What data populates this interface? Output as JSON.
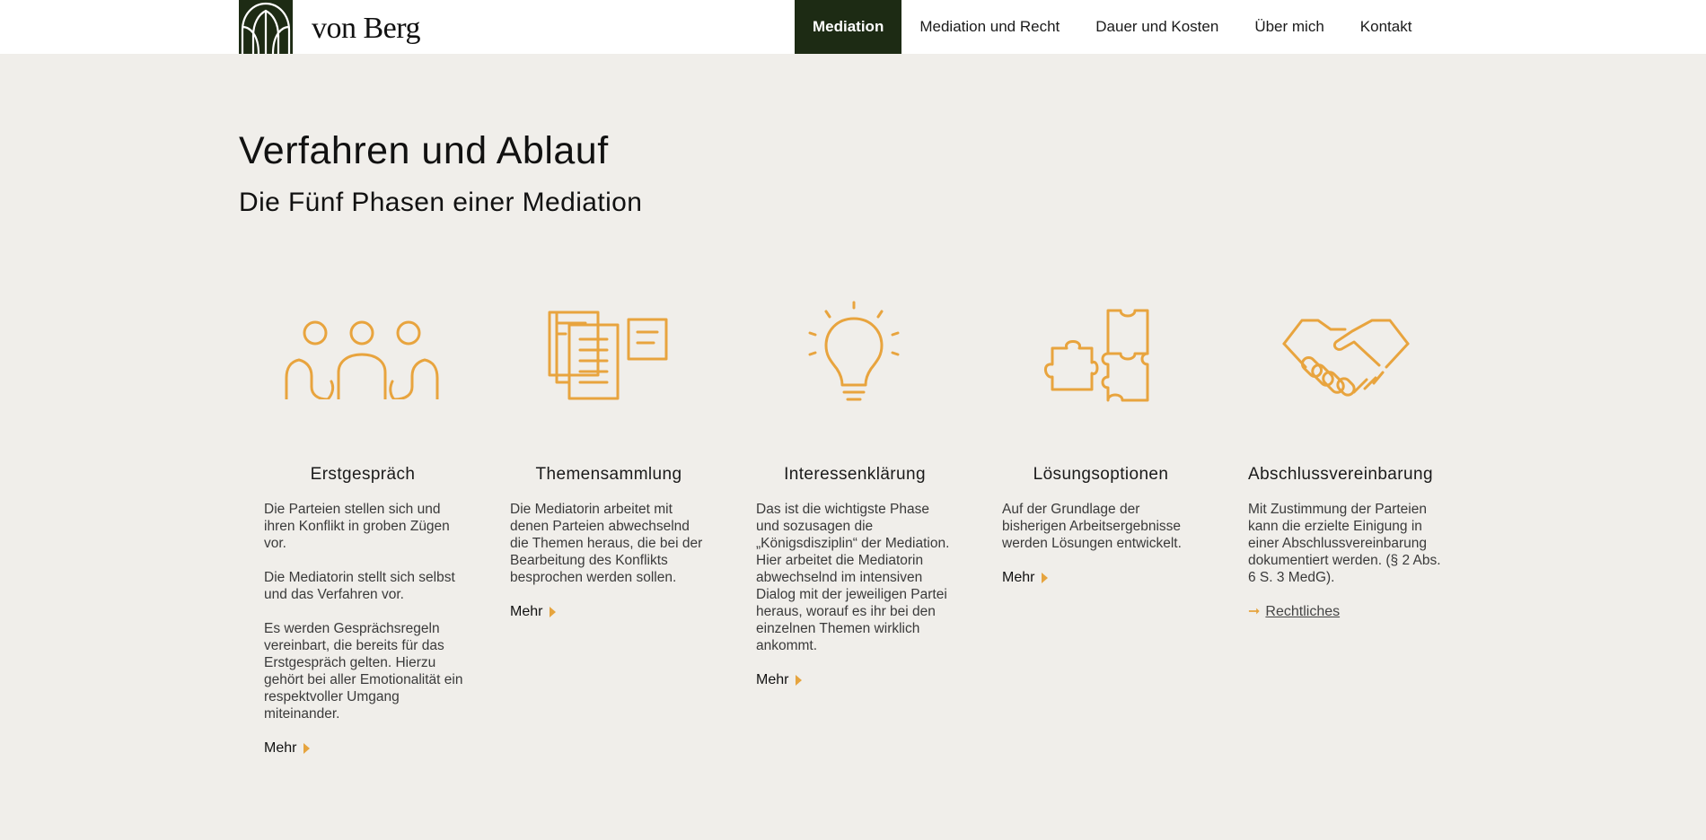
{
  "header": {
    "logo_text": "von Berg",
    "nav": [
      {
        "label": "Mediation",
        "active": true
      },
      {
        "label": "Mediation und Recht",
        "active": false
      },
      {
        "label": "Dauer und Kosten",
        "active": false
      },
      {
        "label": "Über mich",
        "active": false
      },
      {
        "label": "Kontakt",
        "active": false
      }
    ]
  },
  "main": {
    "title": "Verfahren und Ablauf",
    "subtitle": "Die Fünf Phasen einer Mediation"
  },
  "phases": [
    {
      "icon": "people-icon",
      "title": "Erstgespräch",
      "paragraphs": [
        "Die Parteien stellen sich und ihren Konflikt in groben Zügen vor.",
        "Die Mediatorin stellt sich selbst und das Verfahren vor.",
        "Es werden Gesprächsregeln vereinbart, die bereits für das Erstgespräch gelten. Hierzu gehört bei aller Emotionalität ein respektvoller Umgang miteinander."
      ],
      "link": "Mehr"
    },
    {
      "icon": "documents-icon",
      "title": "Themensammlung",
      "paragraphs": [
        "Die Mediatorin arbeitet mit denen Parteien abwechselnd die Themen heraus, die bei der Bearbeitung des Konflikts besprochen werden sollen."
      ],
      "link": "Mehr"
    },
    {
      "icon": "lightbulb-icon",
      "title": "Interessenklärung",
      "paragraphs": [
        "Das ist die wichtigste Phase und sozusagen die „Königsdisziplin“ der Mediation. Hier arbeitet die Mediatorin abwechselnd im intensiven Dialog mit der jeweiligen Partei heraus, worauf es ihr bei den einzelnen Themen wirklich ankommt."
      ],
      "link": "Mehr"
    },
    {
      "icon": "puzzle-icon",
      "title": "Lösungsoptionen",
      "paragraphs": [
        "Auf der Grundlage der bisherigen Arbeitsergebnisse werden Lösungen entwickelt."
      ],
      "link": "Mehr"
    },
    {
      "icon": "handshake-icon",
      "title": "Abschlussvereinbarung",
      "paragraphs": [
        "Mit Zustimmung der Parteien kann die erzielte Einigung in einer Abschlussvereinbarung dokumentiert werden. (§ 2 Abs. 6 S. 3 MedG)."
      ],
      "legal_link": "Rechtliches"
    }
  ],
  "colors": {
    "accent": "#e8a43e",
    "brand_dark": "#1d2b14",
    "background": "#f0eeea"
  }
}
